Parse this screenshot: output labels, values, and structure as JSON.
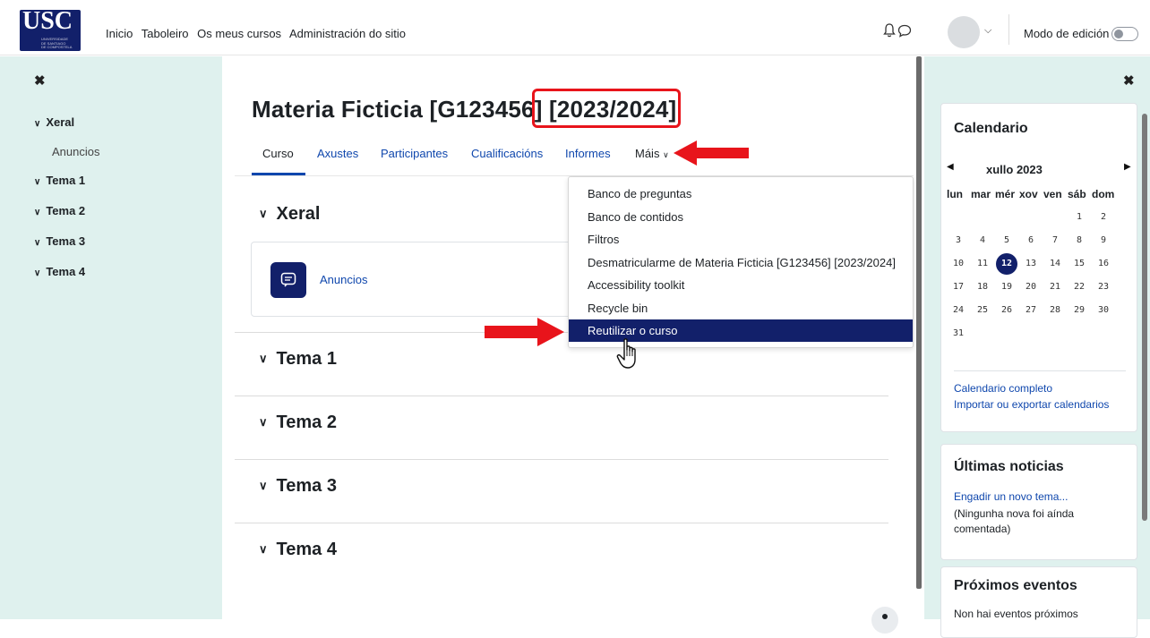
{
  "navbar": {
    "logo_text": "USC",
    "logo_subtext": "UNIVERSIDADE DE SANTIAGO DE COMPOSTELA",
    "links": [
      "Inicio",
      "Taboleiro",
      "Os meus cursos",
      "Administración do sitio"
    ],
    "edit_mode_label": "Modo de edición"
  },
  "left_drawer": {
    "items": [
      {
        "label": "Xeral"
      },
      {
        "label": "Anuncios"
      },
      {
        "label": "Tema 1"
      },
      {
        "label": "Tema 2"
      },
      {
        "label": "Tema 3"
      },
      {
        "label": "Tema 4"
      }
    ]
  },
  "course": {
    "title": "Materia Ficticia [G123456] [2023/2024]",
    "tabs": [
      "Curso",
      "Axustes",
      "Participantes",
      "Cualificacións",
      "Informes",
      "Máis"
    ],
    "sections": [
      "Xeral",
      "Tema 1",
      "Tema 2",
      "Tema 3",
      "Tema 4"
    ],
    "activity_label": "Anuncios"
  },
  "more_menu": {
    "items": [
      "Banco de preguntas",
      "Banco de contidos",
      "Filtros",
      "Desmatricularme de Materia Ficticia [G123456] [2023/2024]",
      "Accessibility toolkit",
      "Recycle bin",
      "Reutilizar o curso"
    ],
    "active_index": 6
  },
  "calendar": {
    "title": "Calendario",
    "month": "xullo 2023",
    "weekdays": [
      "lun",
      "mar",
      "mér",
      "xov",
      "ven",
      "sáb",
      "dom"
    ],
    "weeks": [
      [
        "",
        "",
        "",
        "",
        "",
        "1",
        "2"
      ],
      [
        "3",
        "4",
        "5",
        "6",
        "7",
        "8",
        "9"
      ],
      [
        "10",
        "11",
        "12",
        "13",
        "14",
        "15",
        "16"
      ],
      [
        "17",
        "18",
        "19",
        "20",
        "21",
        "22",
        "23"
      ],
      [
        "24",
        "25",
        "26",
        "27",
        "28",
        "29",
        "30"
      ],
      [
        "31",
        "",
        "",
        "",
        "",
        "",
        ""
      ]
    ],
    "today": "12",
    "full_link": "Calendario completo",
    "import_link": "Importar ou exportar calendarios"
  },
  "news": {
    "title": "Últimas noticias",
    "add_link": "Engadir un novo tema...",
    "empty_text": "(Ningunha nova foi aínda comentada)"
  },
  "events": {
    "title": "Próximos eventos",
    "empty_text": "Non hai eventos próximos"
  },
  "colors": {
    "accent_navy": "#12206a",
    "link_blue": "#0f47ad",
    "drawer_bg": "#dff1ee",
    "annotation_red": "#e8141b"
  }
}
